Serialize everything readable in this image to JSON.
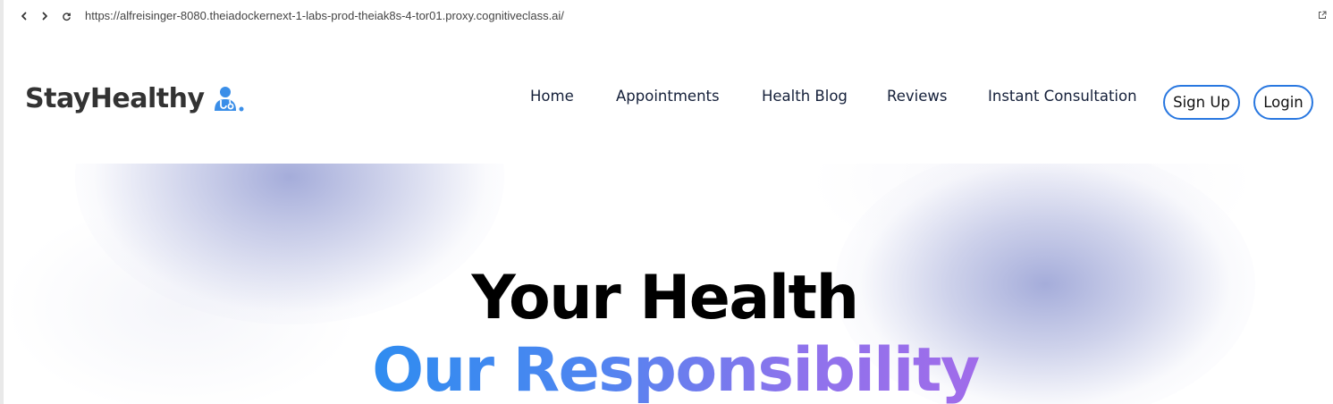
{
  "browser": {
    "url": "https://alfreisinger-8080.theiadockernext-1-labs-prod-theiak8s-4-tor01.proxy.cognitiveclass.ai/",
    "icons": {
      "back": "chevron-left-icon",
      "forward": "chevron-right-icon",
      "reload": "reload-icon",
      "open_external": "external-link-icon"
    }
  },
  "header": {
    "logo_text": "StayHealthy",
    "logo_icon": "doctor-icon",
    "nav": [
      {
        "label": "Home"
      },
      {
        "label": "Appointments"
      },
      {
        "label": "Health Blog"
      },
      {
        "label": "Reviews"
      },
      {
        "label": "Instant Consultation"
      }
    ],
    "signup_label": "Sign Up",
    "login_label": "Login"
  },
  "hero": {
    "line1": "Your Health",
    "line2": "Our Responsibility"
  },
  "colors": {
    "accent_blue": "#2877e0",
    "gradient_start": "#2f8cf0",
    "gradient_end": "#a06cea",
    "blob": "#a0a8d8",
    "text_dark": "#15203a"
  }
}
